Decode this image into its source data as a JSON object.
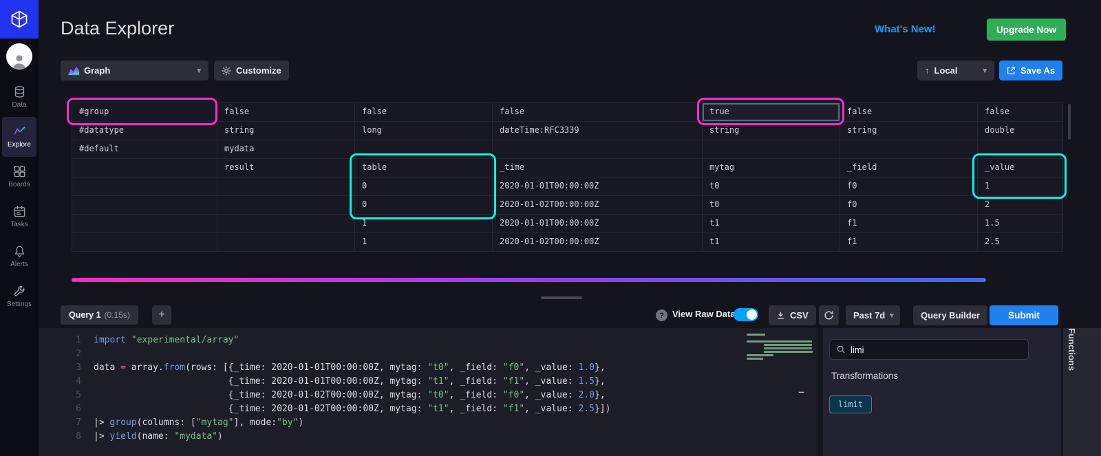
{
  "header": {
    "title": "Data Explorer",
    "whats_new": "What's New!",
    "upgrade": "Upgrade Now"
  },
  "sidebar": {
    "items": [
      {
        "id": "data",
        "label": "Data",
        "icon": "database-icon",
        "active": false
      },
      {
        "id": "explore",
        "label": "Explore",
        "icon": "graph-icon",
        "active": true
      },
      {
        "id": "boards",
        "label": "Boards",
        "icon": "dashboards-icon",
        "active": false
      },
      {
        "id": "tasks",
        "label": "Tasks",
        "icon": "calendar-icon",
        "active": false
      },
      {
        "id": "alerts",
        "label": "Alerts",
        "icon": "bell-icon",
        "active": false
      },
      {
        "id": "settings",
        "label": "Settings",
        "icon": "wrench-icon",
        "active": false
      }
    ]
  },
  "toolbar": {
    "view_type": "Graph",
    "customize": "Customize",
    "local": "Local",
    "save_as": "Save As"
  },
  "raw_table": {
    "rows": [
      [
        "#group",
        "false",
        "false",
        "false",
        "true",
        "false",
        "false"
      ],
      [
        "#datatype",
        "string",
        "long",
        "dateTime:RFC3339",
        "string",
        "string",
        "double"
      ],
      [
        "#default",
        "mydata",
        "",
        "",
        "",
        "",
        ""
      ],
      [
        "",
        "result",
        "table",
        "_time",
        "mytag",
        "_field",
        "_value"
      ],
      [
        "",
        "",
        "0",
        "2020-01-01T00:00:00Z",
        "t0",
        "f0",
        "1"
      ],
      [
        "",
        "",
        "0",
        "2020-01-02T00:00:00Z",
        "t0",
        "f0",
        "2"
      ],
      [
        "",
        "",
        "1",
        "2020-01-01T00:00:00Z",
        "t1",
        "f1",
        "1.5"
      ],
      [
        "",
        "",
        "1",
        "2020-01-02T00:00:00Z",
        "t1",
        "f1",
        "2.5"
      ]
    ]
  },
  "query_bar": {
    "tab_name": "Query 1",
    "tab_time": "(0.15s)",
    "add": "+",
    "view_raw_label": "View Raw Data",
    "csv": "CSV",
    "time_range": "Past 7d",
    "query_builder": "Query Builder",
    "submit": "Submit"
  },
  "editor": {
    "lines": [
      [
        [
          "kw",
          "import"
        ],
        [
          "p",
          " "
        ],
        [
          "str",
          "\"experimental/array\""
        ]
      ],
      [],
      [
        [
          "p",
          "data "
        ],
        [
          "op",
          "="
        ],
        [
          "p",
          " array."
        ],
        [
          "fn",
          "from"
        ],
        [
          "p",
          "(rows: [{_time: 2020-01-01T00:00:00Z, mytag: "
        ],
        [
          "str",
          "\"t0\""
        ],
        [
          "p",
          ", _field: "
        ],
        [
          "str",
          "\"f0\""
        ],
        [
          "p",
          ", _value: "
        ],
        [
          "num",
          "1.0"
        ],
        [
          "p",
          "},"
        ]
      ],
      [
        [
          "p",
          "                         {_time: 2020-01-01T00:00:00Z, mytag: "
        ],
        [
          "str",
          "\"t1\""
        ],
        [
          "p",
          ", _field: "
        ],
        [
          "str",
          "\"f1\""
        ],
        [
          "p",
          ", _value: "
        ],
        [
          "num",
          "1.5"
        ],
        [
          "p",
          "},"
        ]
      ],
      [
        [
          "p",
          "                         {_time: 2020-01-02T00:00:00Z, mytag: "
        ],
        [
          "str",
          "\"t0\""
        ],
        [
          "p",
          ", _field: "
        ],
        [
          "str",
          "\"f0\""
        ],
        [
          "p",
          ", _value: "
        ],
        [
          "num",
          "2.0"
        ],
        [
          "p",
          "},"
        ]
      ],
      [
        [
          "p",
          "                         {_time: 2020-01-02T00:00:00Z, mytag: "
        ],
        [
          "str",
          "\"t1\""
        ],
        [
          "p",
          ", _field: "
        ],
        [
          "str",
          "\"f1\""
        ],
        [
          "p",
          ", _value: "
        ],
        [
          "num",
          "2.5"
        ],
        [
          "p",
          "}])"
        ]
      ],
      [
        [
          "p",
          "|> "
        ],
        [
          "fn",
          "group"
        ],
        [
          "p",
          "(columns: ["
        ],
        [
          "str",
          "\"mytag\""
        ],
        [
          "p",
          "], mode:"
        ],
        [
          "str",
          "\"by\""
        ],
        [
          "p",
          ")"
        ]
      ],
      [
        [
          "p",
          "|> "
        ],
        [
          "fn",
          "yield"
        ],
        [
          "p",
          "(name: "
        ],
        [
          "str",
          "\"mydata\""
        ],
        [
          "p",
          ")"
        ]
      ]
    ]
  },
  "functions_panel": {
    "search_value": "limi",
    "section_title": "Transformations",
    "results": [
      "limit"
    ],
    "tab_label": "Functions"
  },
  "icons": {
    "caret_down": "▾",
    "help": "?",
    "upload_arrow": "↑",
    "scroll_dash": "−"
  },
  "colors": {
    "accent_blue": "#00a3ff",
    "button_blue": "#2180ef",
    "green": "#2fae57",
    "annotation_pink": "#ff2ad0",
    "annotation_cyan": "#0cf2df",
    "logo_blue": "#2334f0"
  }
}
